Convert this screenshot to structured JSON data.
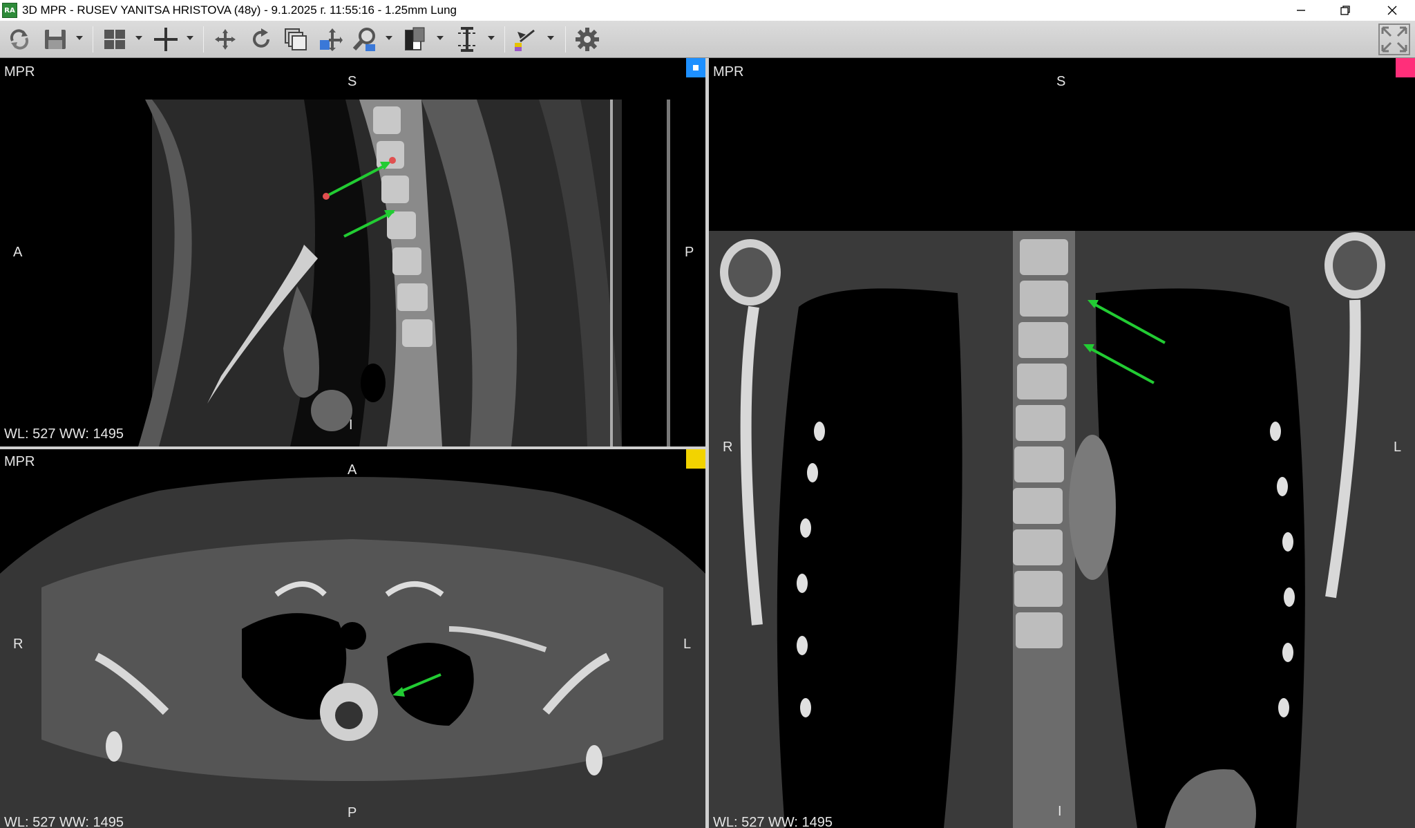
{
  "window": {
    "title": "3D MPR - RUSEV YANITSA HRISTOVA (48y) - 9.1.2025 г. 11:55:16 - 1.25mm Lung",
    "app_icon_text": "RA"
  },
  "toolbar": {
    "tools": [
      "refresh-icon",
      "save-icon",
      "layout-icon",
      "crosshair-icon",
      "rotate-3d-icon",
      "rotate-icon",
      "stack-icon",
      "pan-icon",
      "zoom-icon",
      "window-level-icon",
      "slab-thickness-icon",
      "annotation-icon",
      "settings-icon",
      "fullscreen-icon"
    ]
  },
  "viewports": {
    "sagittal": {
      "mode": "MPR",
      "top": "S",
      "left": "A",
      "right": "P",
      "bottom": "I",
      "wl": "WL: 527 WW: 1495",
      "marker_color": "#1e90ff"
    },
    "axial": {
      "mode": "MPR",
      "top": "A",
      "left": "R",
      "right": "L",
      "bottom": "P",
      "wl": "WL: 527 WW: 1495",
      "marker_color": "#f2d300"
    },
    "coronal": {
      "mode": "MPR",
      "top": "S",
      "left": "R",
      "right": "L",
      "bottom": "I",
      "wl": "WL: 527 WW: 1495",
      "marker_color": "#ff2f7a"
    }
  },
  "colors": {
    "arrow": "#22cc33",
    "measure_point": "#e05050"
  }
}
